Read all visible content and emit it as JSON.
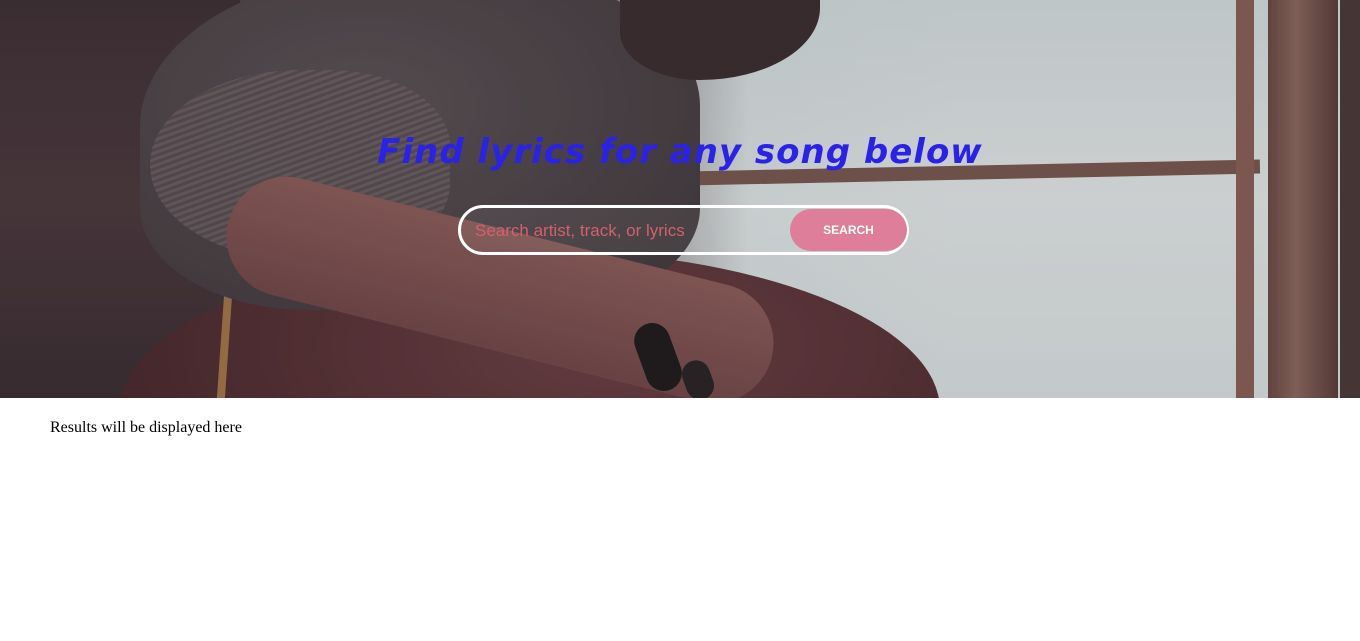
{
  "hero": {
    "headline": "Find lyrics for any song below",
    "headline_color": "#2a22e8"
  },
  "search": {
    "placeholder": "Search artist, track, or lyrics",
    "value": "",
    "button_label": "SEARCH",
    "button_color": "#de7e9a"
  },
  "results": {
    "message": "Results will be displayed here"
  }
}
